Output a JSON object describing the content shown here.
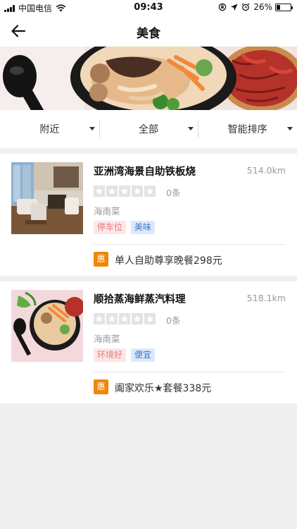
{
  "status_bar": {
    "carrier": "中国电信",
    "time": "09:43",
    "battery_percent": "26%",
    "battery_level": 0.26
  },
  "nav": {
    "title": "美食",
    "back_icon": "arrow-left-icon"
  },
  "filters": [
    {
      "label": "附近"
    },
    {
      "label": "全部"
    },
    {
      "label": "智能排序"
    }
  ],
  "restaurants": [
    {
      "name": "亚洲湾海景自助铁板烧",
      "distance": "514.0km",
      "rating": 0,
      "review_count": "0条",
      "cuisine": "海南菜",
      "tags": [
        "停车位",
        "美味"
      ],
      "promo_badge": "惠",
      "promo_text": "单人自助尊享晚餐298元"
    },
    {
      "name": "顺拾蒸海鲜蒸汽料理",
      "distance": "518.1km",
      "rating": 0,
      "review_count": "0条",
      "cuisine": "海南菜",
      "tags": [
        "环境好",
        "便宜"
      ],
      "promo_badge": "惠",
      "promo_text": "阖家欢乐★套餐338元"
    }
  ],
  "colors": {
    "promo_badge": "#f0870a",
    "tag_pink_bg": "#fde6e6",
    "tag_pink_text": "#e07b7b",
    "tag_blue_bg": "#dbe9fb",
    "tag_blue_text": "#3d78c8",
    "page_bg": "#efefef"
  }
}
